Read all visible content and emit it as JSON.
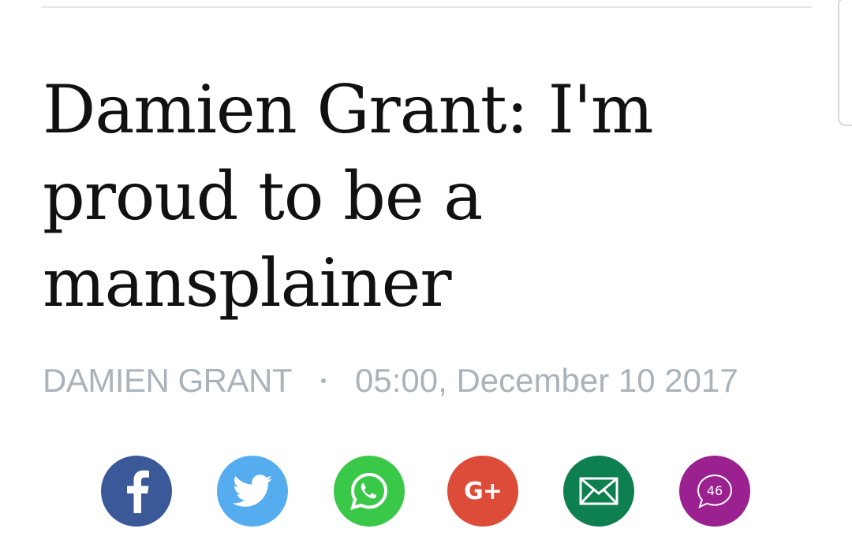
{
  "article": {
    "headline": "Damien Grant: I'm proud to be a mansplainer",
    "author": "DAMIEN GRANT",
    "timestamp": "05:00, December 10 2017"
  },
  "share": {
    "buttons": [
      {
        "name": "facebook",
        "icon": "facebook-icon",
        "color": "#3b5998"
      },
      {
        "name": "twitter",
        "icon": "twitter-icon",
        "color": "#55acee"
      },
      {
        "name": "whatsapp",
        "icon": "whatsapp-icon",
        "color": "#3ac849"
      },
      {
        "name": "google-plus",
        "icon": "google-plus-icon",
        "color": "#dd4b39",
        "label": "G+"
      },
      {
        "name": "email",
        "icon": "envelope-icon",
        "color": "#0e7f4f"
      },
      {
        "name": "comments",
        "icon": "comment-icon",
        "color": "#9b2190",
        "count": "46"
      }
    ]
  }
}
